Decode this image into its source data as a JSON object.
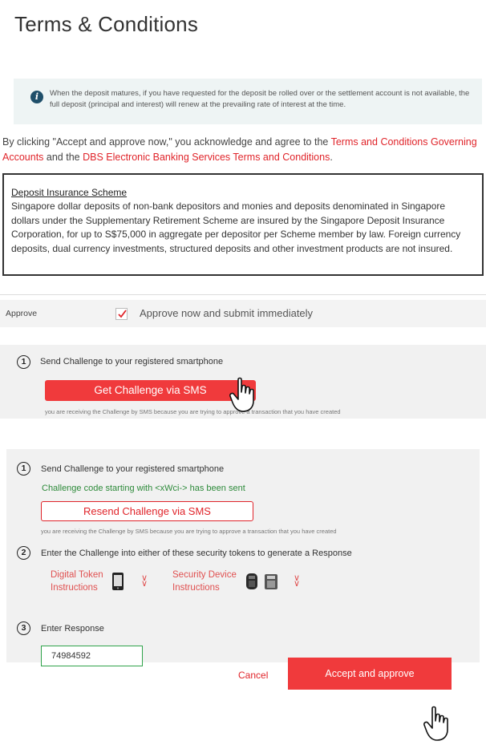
{
  "terms": {
    "title": "Terms & Conditions",
    "info_icon": "info-icon",
    "info_text": "When the deposit matures, if you have requested for the deposit be rolled over or the settlement account is not available, the full deposit (principal and interest) will renew at the prevailing rate of interest at the time.",
    "agree_prefix": "By clicking \"Accept and approve now,\" you acknowledge and agree to the ",
    "agree_link1": "Terms and Conditions Governing Accounts",
    "agree_mid": " and the ",
    "agree_link2": "DBS Electronic Banking Services Terms and Conditions",
    "agree_suffix": ".",
    "disclaimer_title": "Deposit Insurance Scheme",
    "disclaimer_text": "Singapore dollar deposits of non-bank depositors and monies and deposits denominated in Singapore dollars under the Supplementary Retirement Scheme are insured by the Singapore Deposit Insurance Corporation, for up to S$75,000 in aggregate per depositor per Scheme member by law. Foreign currency deposits, dual currency investments, structured deposits and other investment products are not insured."
  },
  "approve": {
    "label": "Approve",
    "checked": true,
    "option_text": "Approve now and submit immediately"
  },
  "challenge_request": {
    "step_number": "1",
    "step_label": "Send Challenge to your registered smartphone",
    "button_label": "Get Challenge via SMS",
    "note": "you are receiving the Challenge by SMS because you are trying to approve a transaction that you have created"
  },
  "challenge_full": {
    "step1_number": "1",
    "step1_label": "Send Challenge to your registered smartphone",
    "sent_message": "Challenge code starting with <xWci-> has been sent",
    "resend_label": "Resend Challenge via SMS",
    "note": "you are receiving the Challenge by SMS because you are trying to approve a transaction that you have created",
    "step2_number": "2",
    "step2_label": "Enter the Challenge into either of these security tokens to generate a Response",
    "token1_line1": "Digital Token",
    "token1_line2": "Instructions",
    "token2_line1": "Security Device",
    "token2_line2": "Instructions",
    "step3_number": "3",
    "step3_label": "Enter Response",
    "response_value": "74984592",
    "cancel_label": "Cancel",
    "accept_label": "Accept and approve"
  },
  "colors": {
    "accent_red": "#f03a3c",
    "link_red": "#e0242a",
    "success_green": "#2d8a3a",
    "info_bg": "#eef4f4"
  }
}
